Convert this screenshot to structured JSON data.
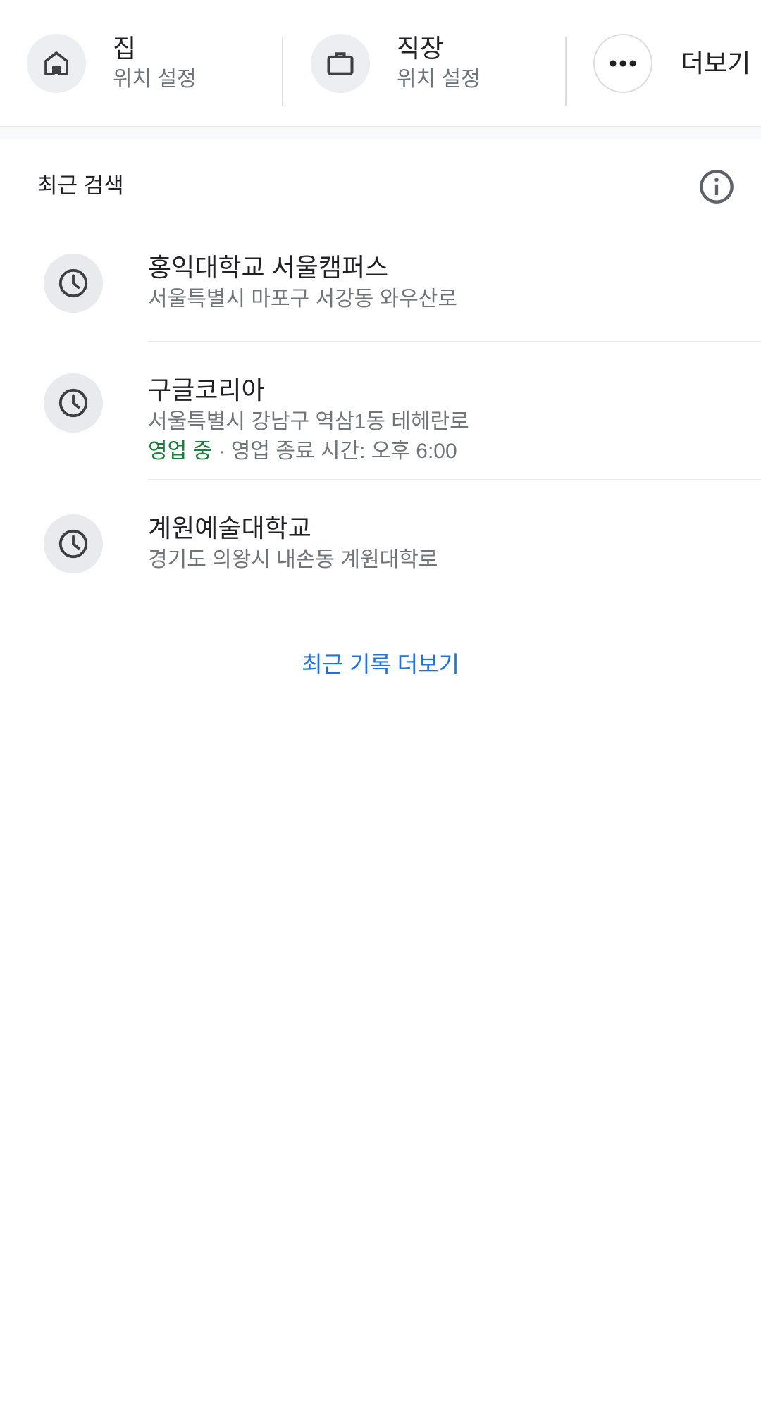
{
  "shortcuts": {
    "home": {
      "title": "집",
      "subtitle": "위치 설정",
      "icon": "home-icon"
    },
    "work": {
      "title": "직장",
      "subtitle": "위치 설정",
      "icon": "briefcase-icon"
    },
    "more": {
      "title": "더보기",
      "icon": "more-horiz-icon"
    }
  },
  "recent": {
    "header": "최근 검색",
    "info_icon": "info-icon",
    "items": [
      {
        "title": "홍익대학교 서울캠퍼스",
        "address": "서울특별시 마포구 서강동 와우산로",
        "icon": "history-clock-icon"
      },
      {
        "title": "구글코리아",
        "address": "서울특별시 강남구 역삼1동 테헤란로",
        "status_open": "영업 중",
        "status_detail": " · 영업 종료 시간: 오후 6:00",
        "icon": "history-clock-icon"
      },
      {
        "title": "계원예술대학교",
        "address": "경기도 의왕시 내손동 계원대학로",
        "icon": "history-clock-icon"
      }
    ],
    "more_link": "최근 기록 더보기"
  },
  "colors": {
    "open_status": "#188038",
    "link": "#1a73e8",
    "secondary_text": "#70757a",
    "icon_bg": "#e8eaed"
  }
}
